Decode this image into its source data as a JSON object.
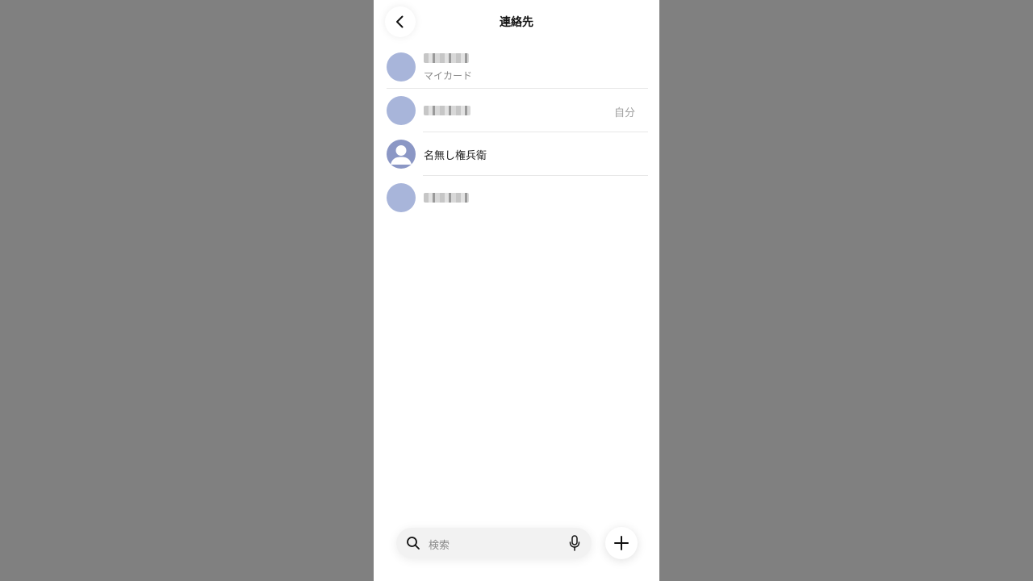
{
  "header": {
    "title": "連絡先",
    "back_icon": "chevron-left-icon"
  },
  "contacts": [
    {
      "name": "",
      "subtitle": "マイカード",
      "trailing": "",
      "avatar": "plain",
      "name_redacted": true
    },
    {
      "name": "",
      "subtitle": "",
      "trailing": "自分",
      "avatar": "plain",
      "name_redacted": true
    },
    {
      "name": "名無し権兵衛",
      "subtitle": "",
      "trailing": "",
      "avatar": "person-icon",
      "name_redacted": false
    },
    {
      "name": "",
      "subtitle": "",
      "trailing": "",
      "avatar": "plain",
      "name_redacted": true
    }
  ],
  "search": {
    "placeholder": "検索",
    "icon": "search-icon",
    "mic_icon": "microphone-icon"
  },
  "add_icon": "plus-icon",
  "colors": {
    "background": "#808080",
    "avatar": "#a8b5da",
    "avatar_person": "#8b97c5"
  }
}
